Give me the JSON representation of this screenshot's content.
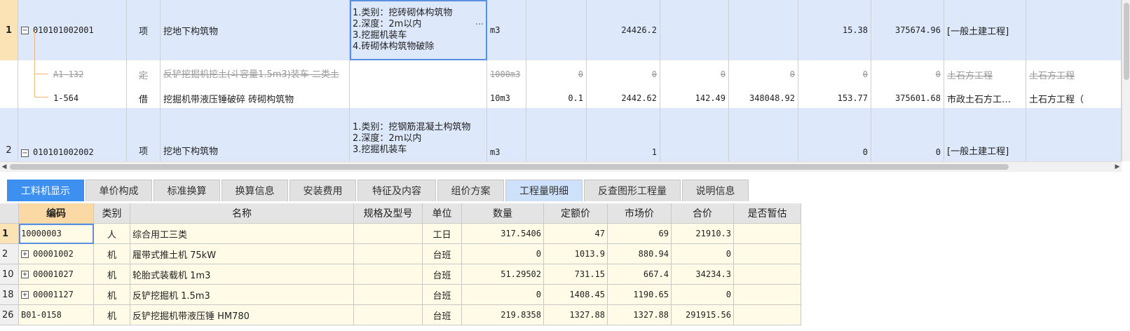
{
  "top_rows": [
    {
      "row_num": "1",
      "code": "010101002001",
      "type": "项",
      "name": "挖地下构筑物",
      "features": [
        "1.类别：挖砖砌体构筑物",
        "2.深度：2m以内",
        "3.挖掘机装车",
        "4.砖砌体构筑物破除"
      ],
      "unit": "m3",
      "qty": "",
      "amount": "24426.2",
      "c1": "",
      "c2": "",
      "c3": "15.38",
      "c4": "375674.96",
      "cat": "[一般土建工程]",
      "cat2": ""
    },
    {
      "row_num": "",
      "code": "A1-132",
      "type": "定",
      "name": "反铲挖掘机挖土(斗容量1.5m3)装车 二类土",
      "features": [],
      "unit": "1000m3",
      "qty": "0",
      "amount": "0",
      "c1": "0",
      "c2": "0",
      "c3": "0",
      "c4": "0",
      "cat": "土石方工程",
      "cat2": "土石方工程"
    },
    {
      "row_num": "",
      "code": "1-564",
      "type": "借",
      "name": "挖掘机带液压锤破碎 砖砌构筑物",
      "features": [],
      "unit": "10m3",
      "qty": "0.1",
      "amount": "2442.62",
      "c1": "142.49",
      "c2": "348048.92",
      "c3": "153.77",
      "c4": "375601.68",
      "cat": "市政土石方工…",
      "cat2": "土石方工程（"
    },
    {
      "row_num": "2",
      "code": "010101002002",
      "type": "项",
      "name": "挖地下构筑物",
      "features": [
        "1.类别：挖钢筋混凝土构筑物",
        "2.深度：2m以内",
        "3.挖掘机装车"
      ],
      "unit": "m3",
      "qty": "",
      "amount": "1",
      "c1": "",
      "c2": "",
      "c3": "0",
      "c4": "0",
      "cat": "[一般土建工程]",
      "cat2": ""
    }
  ],
  "ellipsis": "···",
  "tabs": [
    "工料机显示",
    "单价构成",
    "标准换算",
    "换算信息",
    "安装费用",
    "特征及内容",
    "组价方案",
    "工程量明细",
    "反查图形工程量",
    "说明信息"
  ],
  "bottom_headers": [
    "",
    "编码",
    "类别",
    "名称",
    "规格及型号",
    "单位",
    "数量",
    "定额价",
    "市场价",
    "合价",
    "是否暂估"
  ],
  "bottom_rows": [
    {
      "num": "1",
      "expand": "",
      "code": "10000003",
      "type": "人",
      "name": "综合用工三类",
      "spec": "",
      "unit": "工日",
      "qty": "317.5406",
      "quota": "47",
      "market": "69",
      "total": "21910.3",
      "temp": ""
    },
    {
      "num": "2",
      "expand": "+",
      "code": "00001002",
      "type": "机",
      "name": "履带式推土机 75kW",
      "spec": "",
      "unit": "台班",
      "qty": "0",
      "quota": "1013.9",
      "market": "880.94",
      "total": "0",
      "temp": ""
    },
    {
      "num": "10",
      "expand": "+",
      "code": "00001027",
      "type": "机",
      "name": "轮胎式装载机 1m3",
      "spec": "",
      "unit": "台班",
      "qty": "51.29502",
      "quota": "731.15",
      "market": "667.4",
      "total": "34234.3",
      "temp": ""
    },
    {
      "num": "18",
      "expand": "+",
      "code": "00001127",
      "type": "机",
      "name": "反铲挖掘机 1.5m3",
      "spec": "",
      "unit": "台班",
      "qty": "0",
      "quota": "1408.45",
      "market": "1190.65",
      "total": "0",
      "temp": ""
    },
    {
      "num": "26",
      "expand": "",
      "code": "B01-0158",
      "type": "机",
      "name": "反铲挖掘机带液压锤 HM780",
      "spec": "",
      "unit": "台班",
      "qty": "219.8358",
      "quota": "1327.88",
      "market": "1327.88",
      "total": "291915.56",
      "temp": ""
    }
  ],
  "colors": {
    "accent": "#3d8ff0",
    "row_selected": "#dde8fb",
    "header_highlight": "#fbd9a5",
    "bottom_row_bg": "#fffbe6"
  }
}
